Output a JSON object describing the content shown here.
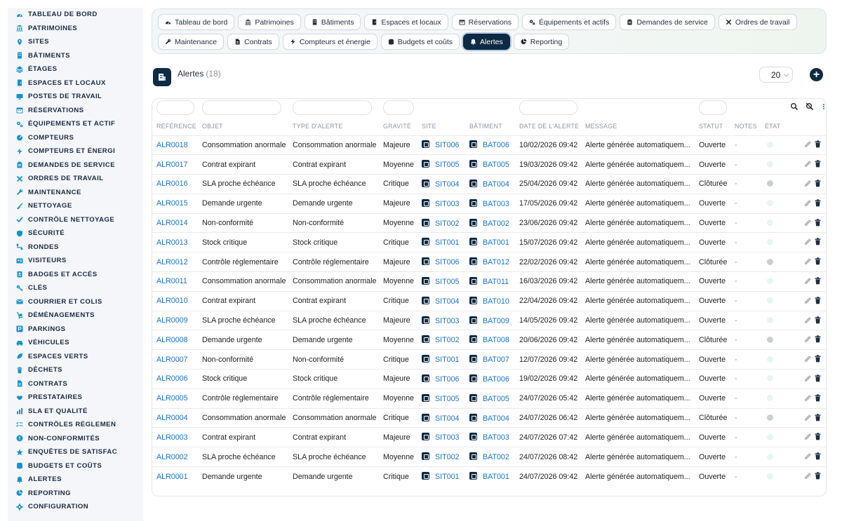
{
  "colors": {
    "brand": "#0f2a44",
    "link": "#1a73c9",
    "dot_open": "#e6f5ef",
    "dot_closed": "#c9ced3"
  },
  "sidebar": {
    "items": [
      {
        "label": "TABLEAU DE BORD",
        "icon": "dashboard-icon"
      },
      {
        "label": "PATRIMOINES",
        "icon": "building-columns-icon"
      },
      {
        "label": "SITES",
        "icon": "map-pin-icon"
      },
      {
        "label": "BÂTIMENTS",
        "icon": "building-icon"
      },
      {
        "label": "ÉTAGES",
        "icon": "layers-icon"
      },
      {
        "label": "ESPACES ET LOCAUX",
        "icon": "door-icon"
      },
      {
        "label": "POSTES DE TRAVAIL",
        "icon": "desktop-icon"
      },
      {
        "label": "RÉSERVATIONS",
        "icon": "calendar-icon"
      },
      {
        "label": "ÉQUIPEMENTS ET ACTIF",
        "icon": "gears-icon"
      },
      {
        "label": "COMPTEURS",
        "icon": "gauge-icon"
      },
      {
        "label": "COMPTEURS ET ÉNERGI",
        "icon": "bolt-icon"
      },
      {
        "label": "DEMANDES DE SERVICE",
        "icon": "clipboard-icon"
      },
      {
        "label": "ORDRES DE TRAVAIL",
        "icon": "tools-icon"
      },
      {
        "label": "MAINTENANCE",
        "icon": "wrench-icon"
      },
      {
        "label": "NETTOYAGE",
        "icon": "broom-icon"
      },
      {
        "label": "CONTRÔLE NETTOYAGE",
        "icon": "check-icon"
      },
      {
        "label": "SÉCURITÉ",
        "icon": "shield-icon"
      },
      {
        "label": "RONDES",
        "icon": "route-icon"
      },
      {
        "label": "VISITEURS",
        "icon": "id-card-icon"
      },
      {
        "label": "BADGES ET ACCÈS",
        "icon": "badge-icon"
      },
      {
        "label": "CLÉS",
        "icon": "key-icon"
      },
      {
        "label": "COURRIER ET COLIS",
        "icon": "envelope-icon"
      },
      {
        "label": "DÉMÉNAGEMENTS",
        "icon": "dolly-icon"
      },
      {
        "label": "PARKINGS",
        "icon": "parking-icon"
      },
      {
        "label": "VÉHICULES",
        "icon": "car-icon"
      },
      {
        "label": "ESPACES VERTS",
        "icon": "leaf-icon"
      },
      {
        "label": "DÉCHETS",
        "icon": "trash-icon"
      },
      {
        "label": "CONTRATS",
        "icon": "document-icon"
      },
      {
        "label": "PRESTATAIRES",
        "icon": "handshake-icon"
      },
      {
        "label": "SLA ET QUALITÉ",
        "icon": "chart-icon"
      },
      {
        "label": "CONTRÔLES RÉGLEMEN",
        "icon": "list-check-icon"
      },
      {
        "label": "NON-CONFORMITÉS",
        "icon": "warning-icon"
      },
      {
        "label": "ENQUÊTES DE SATISFAC",
        "icon": "star-icon"
      },
      {
        "label": "BUDGETS ET COÛTS",
        "icon": "coins-icon"
      },
      {
        "label": "ALERTES",
        "icon": "bell-icon"
      },
      {
        "label": "REPORTING",
        "icon": "pie-icon"
      },
      {
        "label": "CONFIGURATION",
        "icon": "gear-icon"
      }
    ]
  },
  "tabs": [
    [
      {
        "label": "Tableau de bord",
        "icon": "dashboard-icon"
      },
      {
        "label": "Patrimoines",
        "icon": "building-columns-icon"
      },
      {
        "label": "Bâtiments",
        "icon": "building-icon"
      },
      {
        "label": "Espaces et locaux",
        "icon": "door-icon"
      },
      {
        "label": "Réservations",
        "icon": "calendar-icon"
      },
      {
        "label": "Équipements et actifs",
        "icon": "gears-icon"
      },
      {
        "label": "Demandes de service",
        "icon": "clipboard-icon"
      },
      {
        "label": "Ordres de travail",
        "icon": "tools-icon"
      }
    ],
    [
      {
        "label": "Maintenance",
        "icon": "wrench-icon"
      },
      {
        "label": "Contrats",
        "icon": "document-icon"
      },
      {
        "label": "Compteurs et énergie",
        "icon": "bolt-icon"
      },
      {
        "label": "Budgets et coûts",
        "icon": "coins-icon"
      },
      {
        "label": "Alertes",
        "icon": "bell-icon",
        "active": true
      },
      {
        "label": "Reporting",
        "icon": "pie-icon"
      }
    ]
  ],
  "page": {
    "title": "Alertes",
    "count": "(18)",
    "page_size": "20"
  },
  "table": {
    "columns": [
      "Référence",
      "Objet",
      "Type d'alerte",
      "Gravité",
      "Site",
      "Bâtiment",
      "Date de l'alerte",
      "Message",
      "Statut",
      "Notes",
      "État"
    ],
    "rows": [
      [
        "ALR0018",
        "Consommation anormale",
        "Consommation anormale",
        "Majeure",
        "SIT006",
        "BAT006",
        "10/02/2026 09:42",
        "Alerte générée automatiquem...",
        "Ouverte",
        "-",
        "open"
      ],
      [
        "ALR0017",
        "Contrat expirant",
        "Contrat expirant",
        "Moyenne",
        "SIT005",
        "BAT005",
        "19/03/2026 09:42",
        "Alerte générée automatiquem...",
        "Ouverte",
        "-",
        "open"
      ],
      [
        "ALR0016",
        "SLA proche échéance",
        "SLA proche échéance",
        "Critique",
        "SIT004",
        "BAT004",
        "25/04/2026 09:42",
        "Alerte générée automatiquem...",
        "Clôturée",
        "-",
        "closed"
      ],
      [
        "ALR0015",
        "Demande urgente",
        "Demande urgente",
        "Majeure",
        "SIT003",
        "BAT003",
        "17/05/2026 09:42",
        "Alerte générée automatiquem...",
        "Ouverte",
        "-",
        "open"
      ],
      [
        "ALR0014",
        "Non-conformité",
        "Non-conformité",
        "Moyenne",
        "SIT002",
        "BAT002",
        "23/06/2026 09:42",
        "Alerte générée automatiquem...",
        "Ouverte",
        "-",
        "open"
      ],
      [
        "ALR0013",
        "Stock critique",
        "Stock critique",
        "Critique",
        "SIT001",
        "BAT001",
        "15/07/2026 09:42",
        "Alerte générée automatiquem...",
        "Ouverte",
        "-",
        "open"
      ],
      [
        "ALR0012",
        "Contrôle réglementaire",
        "Contrôle réglementaire",
        "Majeure",
        "SIT006",
        "BAT012",
        "22/02/2026 09:42",
        "Alerte générée automatiquem...",
        "Clôturée",
        "-",
        "closed"
      ],
      [
        "ALR0011",
        "Consommation anormale",
        "Consommation anormale",
        "Moyenne",
        "SIT005",
        "BAT011",
        "16/03/2026 09:42",
        "Alerte générée automatiquem...",
        "Ouverte",
        "-",
        "open"
      ],
      [
        "ALR0010",
        "Contrat expirant",
        "Contrat expirant",
        "Critique",
        "SIT004",
        "BAT010",
        "22/04/2026 09:42",
        "Alerte générée automatiquem...",
        "Ouverte",
        "-",
        "open"
      ],
      [
        "ALR0009",
        "SLA proche échéance",
        "SLA proche échéance",
        "Majeure",
        "SIT003",
        "BAT009",
        "14/05/2026 09:42",
        "Alerte générée automatiquem...",
        "Ouverte",
        "-",
        "open"
      ],
      [
        "ALR0008",
        "Demande urgente",
        "Demande urgente",
        "Moyenne",
        "SIT002",
        "BAT008",
        "20/06/2026 09:42",
        "Alerte générée automatiquem...",
        "Clôturée",
        "-",
        "closed"
      ],
      [
        "ALR0007",
        "Non-conformité",
        "Non-conformité",
        "Critique",
        "SIT001",
        "BAT007",
        "12/07/2026 09:42",
        "Alerte générée automatiquem...",
        "Ouverte",
        "-",
        "open"
      ],
      [
        "ALR0006",
        "Stock critique",
        "Stock critique",
        "Majeure",
        "SIT006",
        "BAT006",
        "19/02/2026 09:42",
        "Alerte générée automatiquem...",
        "Ouverte",
        "-",
        "open"
      ],
      [
        "ALR0005",
        "Contrôle réglementaire",
        "Contrôle réglementaire",
        "Moyenne",
        "SIT005",
        "BAT005",
        "24/07/2026 05:42",
        "Alerte générée automatiquem...",
        "Ouverte",
        "-",
        "open"
      ],
      [
        "ALR0004",
        "Consommation anormale",
        "Consommation anormale",
        "Critique",
        "SIT004",
        "BAT004",
        "24/07/2026 06:42",
        "Alerte générée automatiquem...",
        "Clôturée",
        "-",
        "closed"
      ],
      [
        "ALR0003",
        "Contrat expirant",
        "Contrat expirant",
        "Majeure",
        "SIT003",
        "BAT003",
        "24/07/2026 07:42",
        "Alerte générée automatiquem...",
        "Ouverte",
        "-",
        "open"
      ],
      [
        "ALR0002",
        "SLA proche échéance",
        "SLA proche échéance",
        "Moyenne",
        "SIT002",
        "BAT002",
        "24/07/2026 08:42",
        "Alerte générée automatiquem...",
        "Ouverte",
        "-",
        "open"
      ],
      [
        "ALR0001",
        "Demande urgente",
        "Demande urgente",
        "Critique",
        "SIT001",
        "BAT001",
        "24/07/2026 09:42",
        "Alerte générée automatiquem...",
        "Ouverte",
        "-",
        "open"
      ]
    ]
  }
}
